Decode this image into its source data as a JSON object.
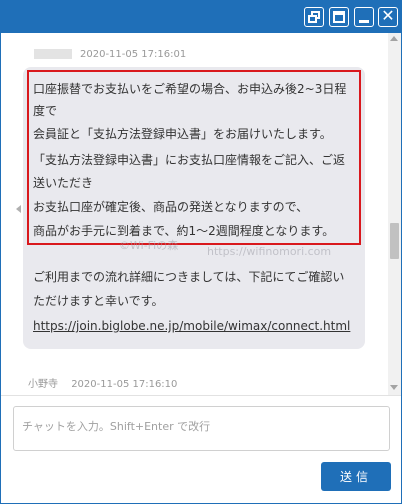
{
  "titlebar": {
    "buttons": [
      {
        "name": "popout",
        "icon": "popout-window-icon"
      },
      {
        "name": "maximize",
        "icon": "maximize-icon"
      },
      {
        "name": "minimize",
        "icon": "minimize-icon"
      },
      {
        "name": "close",
        "icon": "close-icon",
        "glyph": "✕"
      }
    ],
    "accent_color": "#1f6fb8"
  },
  "messages": [
    {
      "timestamp": "2020-11-05 17:16:01",
      "highlighted_lines": [
        "口座振替でお支払いをご希望の場合、お申込み後2~3日程",
        "度で",
        "会員証と「支払方法登録申込書」をお届けいたします。",
        "「支払方法登録申込書」にお支払口座情報をご記入、ご返",
        "送いただき",
        "お支払口座が確定後、商品の発送となりますので、",
        "商品がお手元に到着まで、約1～2週間程度となります。"
      ],
      "lines": [
        "ご利用までの流れ詳細につきましては、下記にてご確認い",
        "ただけますと幸いです。"
      ],
      "link": "https://join.biglobe.ne.jp/mobile/wimax/connect.html",
      "highlight_color": "#d9181d"
    },
    {
      "sender": "小野寺",
      "timestamp": "2020-11-05 17:16:10"
    }
  ],
  "watermarks": [
    "©Wi-Fiの森",
    "https://wifinomori.com"
  ],
  "composer": {
    "placeholder": "チャットを入力。Shift+Enter で改行",
    "value": "",
    "send_label": "送信"
  }
}
